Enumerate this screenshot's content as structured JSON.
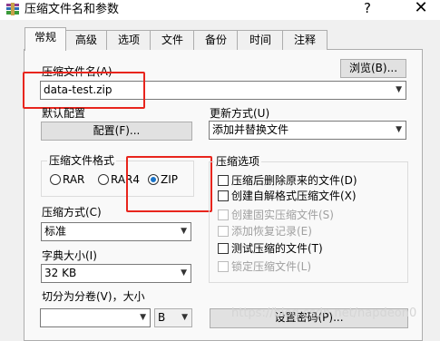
{
  "window": {
    "title": "压缩文件名和参数",
    "help_label": "?",
    "close_label": "✕"
  },
  "tabs": [
    {
      "label": "常规",
      "active": true
    },
    {
      "label": "高级"
    },
    {
      "label": "选项"
    },
    {
      "label": "文件"
    },
    {
      "label": "备份"
    },
    {
      "label": "时间"
    },
    {
      "label": "注释"
    }
  ],
  "archive": {
    "name_label": "压缩文件名(A)",
    "name_value": "data-test.zip",
    "browse_label": "浏览(B)..."
  },
  "profile": {
    "label": "默认配置",
    "button_label": "配置(F)..."
  },
  "update": {
    "label": "更新方式(U)",
    "value": "添加并替换文件"
  },
  "format": {
    "group_label": "压缩文件格式",
    "options": [
      "RAR",
      "RAR4",
      "ZIP"
    ],
    "selected": "ZIP"
  },
  "method": {
    "label": "压缩方式(C)",
    "value": "标准"
  },
  "dictionary": {
    "label": "字典大小(I)",
    "value": "32 KB"
  },
  "split": {
    "label": "切分为分卷(V)，大小",
    "value": "",
    "unit": "B"
  },
  "password_button": "设置密码(P)...",
  "options": {
    "group_label": "压缩选项",
    "items": [
      {
        "label": "压缩后删除原来的文件(D)",
        "checked": false,
        "enabled": true
      },
      {
        "label": "创建自解格式压缩文件(X)",
        "checked": false,
        "enabled": true
      },
      {
        "label": "创建固实压缩文件(S)",
        "checked": false,
        "enabled": false
      },
      {
        "label": "添加恢复记录(E)",
        "checked": false,
        "enabled": false
      },
      {
        "label": "测试压缩的文件(T)",
        "checked": false,
        "enabled": true
      },
      {
        "label": "锁定压缩文件(L)",
        "checked": false,
        "enabled": false
      }
    ]
  },
  "watermark": "https://blog.csdn.net/napdeon0",
  "colors": {
    "highlight": "#e8251d",
    "radio_selected": "#1a73c8"
  }
}
